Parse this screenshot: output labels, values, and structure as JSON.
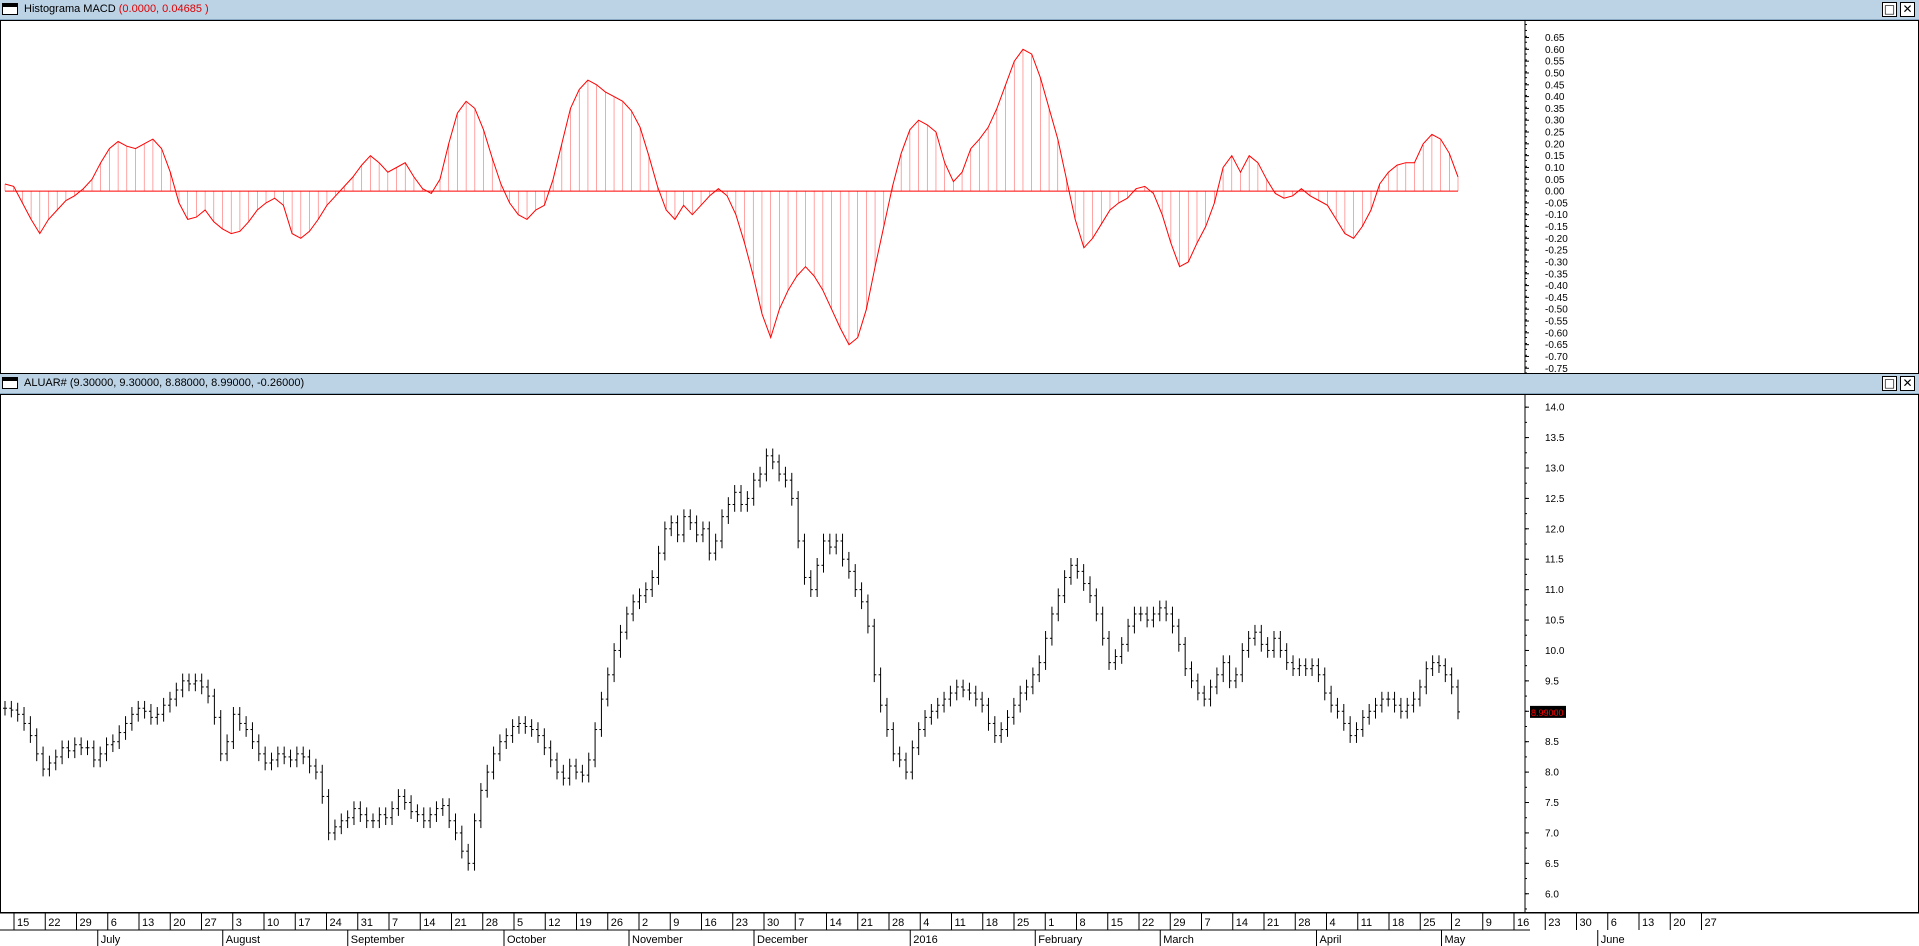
{
  "macd_panel": {
    "title": "Histograma MACD",
    "title_values": "(0.0000, 0.04685 )"
  },
  "price_panel": {
    "title": "ALUAR#",
    "title_values": "(9.30000, 9.30000, 8.88000, 8.99000, -0.26000)",
    "last_price_label": "8.99000"
  },
  "window_buttons": {
    "maximize": "□",
    "close": "✕"
  },
  "colors": {
    "macd_line": "#ff0000",
    "price_bars": "#000000",
    "title_bar": "#bcd3e6",
    "last_price_bg": "#000000",
    "last_price_text": "#ff0000"
  },
  "chart_data": [
    {
      "type": "line",
      "title": "Histograma MACD",
      "ylim": [
        -0.77,
        0.72
      ],
      "yticks": [
        0.65,
        0.6,
        0.55,
        0.5,
        0.45,
        0.4,
        0.35,
        0.3,
        0.25,
        0.2,
        0.15,
        0.1,
        0.05,
        0.0,
        -0.05,
        -0.1,
        -0.15,
        -0.2,
        -0.25,
        -0.3,
        -0.35,
        -0.4,
        -0.45,
        -0.5,
        -0.55,
        -0.6,
        -0.65,
        -0.7,
        -0.75
      ],
      "ytick_labels": [
        "0.65",
        "0.60",
        "0.55",
        "0.50",
        "0.45",
        "0.40",
        "0.35",
        "0.30",
        "0.25",
        "0.20",
        "0.15",
        "0.10",
        "0.05",
        "0.00",
        "-0.05",
        "-0.10",
        "-0.15",
        "-0.20",
        "-0.25",
        "-0.30",
        "-0.35",
        "-0.40",
        "-0.45",
        "-0.50",
        "-0.55",
        "-0.60",
        "-0.65",
        "-0.70",
        "-0.75"
      ],
      "series": [
        {
          "values": [
            0.03,
            0.02,
            -0.05,
            -0.12,
            -0.18,
            -0.12,
            -0.08,
            -0.04,
            -0.02,
            0.01,
            0.05,
            0.12,
            0.18,
            0.21,
            0.19,
            0.18,
            0.2,
            0.22,
            0.18,
            0.08,
            -0.05,
            -0.12,
            -0.11,
            -0.08,
            -0.13,
            -0.16,
            -0.18,
            -0.17,
            -0.13,
            -0.08,
            -0.05,
            -0.03,
            -0.06,
            -0.18,
            -0.2,
            -0.17,
            -0.12,
            -0.06,
            -0.02,
            0.02,
            0.06,
            0.11,
            0.15,
            0.12,
            0.08,
            0.1,
            0.12,
            0.06,
            0.01,
            -0.01,
            0.05,
            0.2,
            0.33,
            0.38,
            0.35,
            0.26,
            0.14,
            0.03,
            -0.05,
            -0.1,
            -0.12,
            -0.08,
            -0.06,
            0.05,
            0.2,
            0.35,
            0.43,
            0.47,
            0.45,
            0.42,
            0.4,
            0.38,
            0.34,
            0.27,
            0.15,
            0.02,
            -0.08,
            -0.12,
            -0.06,
            -0.1,
            -0.06,
            -0.02,
            0.01,
            -0.02,
            -0.1,
            -0.22,
            -0.36,
            -0.52,
            -0.62,
            -0.5,
            -0.42,
            -0.36,
            -0.32,
            -0.36,
            -0.42,
            -0.5,
            -0.58,
            -0.65,
            -0.62,
            -0.5,
            -0.32,
            -0.15,
            0.02,
            0.16,
            0.26,
            0.3,
            0.28,
            0.25,
            0.12,
            0.04,
            0.08,
            0.18,
            0.22,
            0.27,
            0.35,
            0.45,
            0.55,
            0.6,
            0.58,
            0.48,
            0.35,
            0.22,
            0.05,
            -0.12,
            -0.24,
            -0.2,
            -0.14,
            -0.08,
            -0.05,
            -0.03,
            0.01,
            0.02,
            -0.01,
            -0.1,
            -0.22,
            -0.32,
            -0.3,
            -0.22,
            -0.15,
            -0.05,
            0.1,
            0.15,
            0.08,
            0.15,
            0.12,
            0.05,
            -0.01,
            -0.03,
            -0.02,
            0.01,
            -0.02,
            -0.04,
            -0.06,
            -0.12,
            -0.18,
            -0.2,
            -0.15,
            -0.08,
            0.03,
            0.08,
            0.11,
            0.12,
            0.12,
            0.2,
            0.24,
            0.22,
            0.16,
            0.06
          ]
        }
      ]
    },
    {
      "type": "bar",
      "title": "ALUAR#",
      "ylim": [
        5.7,
        14.2
      ],
      "yticks": [
        14.0,
        13.5,
        13.0,
        12.5,
        12.0,
        11.5,
        11.0,
        10.5,
        10.0,
        9.5,
        9.0,
        8.5,
        8.0,
        7.5,
        7.0,
        6.5,
        6.0
      ],
      "ytick_labels": [
        "14.0",
        "13.5",
        "13.0",
        "12.5",
        "12.0",
        "11.5",
        "11.0",
        "10.5",
        "10.0",
        "9.5",
        "9.0",
        "8.5",
        "8.0",
        "7.5",
        "7.0",
        "6.5",
        "6.0"
      ],
      "close": [
        9.05,
        9.02,
        8.95,
        8.8,
        8.6,
        8.3,
        8.05,
        8.15,
        8.25,
        8.4,
        8.35,
        8.45,
        8.4,
        8.4,
        8.2,
        8.3,
        8.45,
        8.5,
        8.65,
        8.8,
        8.95,
        9.05,
        9.0,
        8.9,
        8.95,
        9.1,
        9.2,
        9.35,
        9.5,
        9.45,
        9.5,
        9.4,
        9.25,
        8.9,
        8.3,
        8.5,
        8.95,
        8.8,
        8.7,
        8.5,
        8.3,
        8.15,
        8.2,
        8.3,
        8.25,
        8.2,
        8.3,
        8.25,
        8.1,
        8.0,
        7.6,
        7.0,
        7.1,
        7.2,
        7.25,
        7.4,
        7.3,
        7.2,
        7.2,
        7.3,
        7.25,
        7.4,
        7.6,
        7.5,
        7.35,
        7.3,
        7.2,
        7.3,
        7.4,
        7.45,
        7.2,
        7.0,
        6.7,
        6.5,
        7.2,
        7.7,
        8.0,
        8.3,
        8.5,
        8.6,
        8.75,
        8.8,
        8.75,
        8.7,
        8.6,
        8.4,
        8.2,
        8.0,
        7.9,
        8.1,
        8.0,
        7.95,
        8.2,
        8.7,
        9.2,
        9.6,
        10.0,
        10.3,
        10.6,
        10.8,
        10.9,
        11.0,
        11.2,
        11.6,
        12.0,
        12.1,
        11.9,
        12.2,
        12.1,
        11.9,
        12.0,
        11.6,
        11.8,
        12.2,
        12.4,
        12.6,
        12.4,
        12.5,
        12.8,
        12.9,
        13.2,
        13.1,
        12.9,
        12.8,
        12.5,
        11.8,
        11.2,
        11.0,
        11.4,
        11.8,
        11.7,
        11.8,
        11.5,
        11.3,
        11.0,
        10.8,
        10.4,
        9.6,
        9.1,
        8.7,
        8.3,
        8.2,
        8.0,
        8.4,
        8.7,
        8.9,
        9.0,
        9.1,
        9.2,
        9.3,
        9.4,
        9.35,
        9.3,
        9.2,
        9.1,
        8.8,
        8.6,
        8.7,
        8.9,
        9.1,
        9.3,
        9.4,
        9.6,
        9.8,
        10.2,
        10.6,
        10.9,
        11.2,
        11.4,
        11.3,
        11.1,
        10.9,
        10.6,
        10.2,
        9.8,
        9.9,
        10.1,
        10.4,
        10.6,
        10.6,
        10.5,
        10.6,
        10.7,
        10.6,
        10.4,
        10.1,
        9.7,
        9.5,
        9.3,
        9.2,
        9.4,
        9.6,
        9.8,
        9.5,
        9.6,
        10.0,
        10.2,
        10.3,
        10.1,
        10.0,
        10.2,
        10.0,
        9.8,
        9.7,
        9.75,
        9.7,
        9.75,
        9.6,
        9.3,
        9.1,
        9.0,
        8.8,
        8.6,
        8.7,
        8.9,
        9.0,
        9.1,
        9.2,
        9.2,
        9.1,
        9.0,
        9.1,
        9.2,
        9.4,
        9.7,
        9.8,
        9.75,
        9.6,
        9.4,
        8.99
      ]
    }
  ],
  "x_axis": {
    "day_labels": [
      "15",
      "22",
      "29",
      "6",
      "13",
      "20",
      "27",
      "3",
      "10",
      "17",
      "24",
      "31",
      "7",
      "14",
      "21",
      "28",
      "5",
      "12",
      "19",
      "26",
      "2",
      "9",
      "16",
      "23",
      "30",
      "7",
      "14",
      "21",
      "28",
      "4",
      "11",
      "18",
      "25",
      "1",
      "8",
      "15",
      "22",
      "29",
      "7",
      "14",
      "21",
      "28",
      "4",
      "11",
      "18",
      "25",
      "2",
      "9",
      "16",
      "23",
      "30",
      "6",
      "13",
      "20",
      "27"
    ],
    "month_labels": [
      "July",
      "August",
      "September",
      "October",
      "November",
      "December",
      "2016",
      "February",
      "March",
      "April",
      "May",
      "June"
    ]
  }
}
